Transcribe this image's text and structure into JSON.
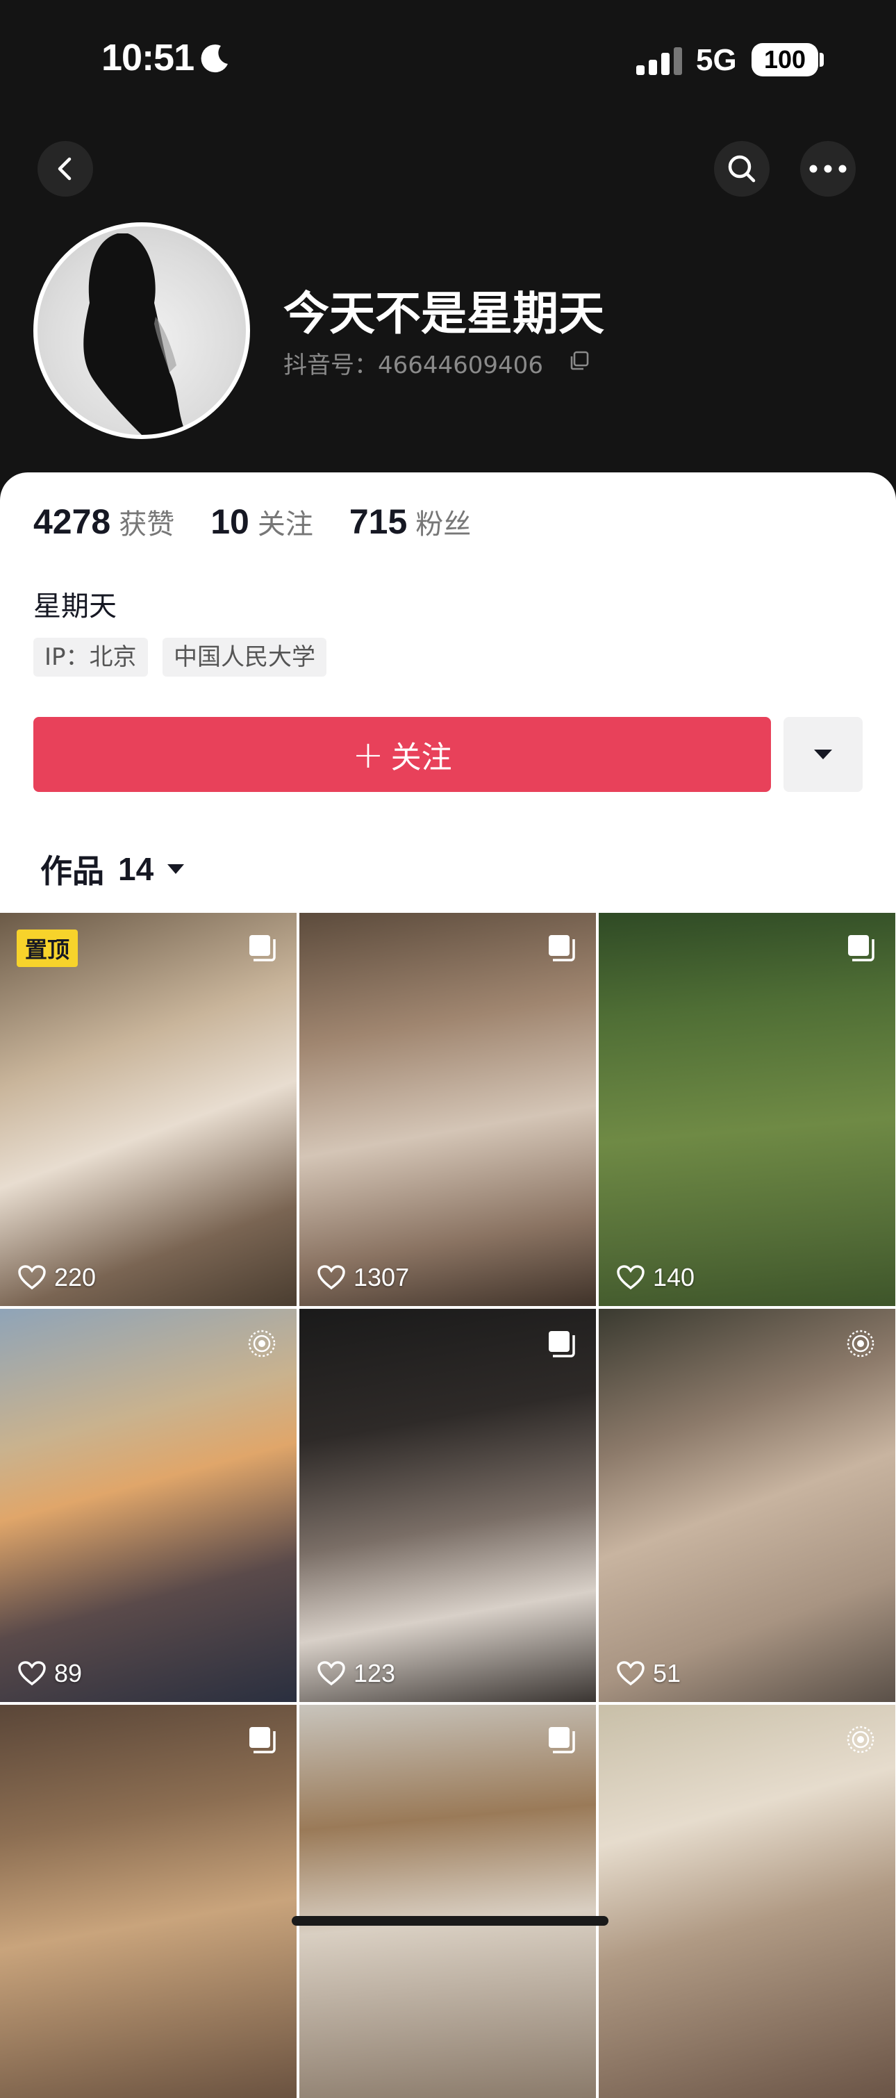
{
  "status_bar": {
    "time": "10:51",
    "network": "5G",
    "battery": "100"
  },
  "profile": {
    "nickname": "今天不是星期天",
    "douyin_id": "抖音号：46644609406",
    "bio": "星期天",
    "tags": [
      "IP：北京",
      "中国人民大学"
    ]
  },
  "stats": [
    {
      "value": "4278",
      "label": "获赞"
    },
    {
      "value": "10",
      "label": "关注"
    },
    {
      "value": "715",
      "label": "粉丝"
    }
  ],
  "actions": {
    "follow_label": "关注"
  },
  "works": {
    "tab_label": "作品",
    "count": "14",
    "pinned_label": "置顶",
    "items": [
      {
        "likes": "220",
        "type": "multi-image-icon",
        "pinned": true
      },
      {
        "likes": "1307",
        "type": "multi-image-icon",
        "pinned": false
      },
      {
        "likes": "140",
        "type": "multi-image-icon",
        "pinned": false
      },
      {
        "likes": "89",
        "type": "live-photo-icon",
        "pinned": false
      },
      {
        "likes": "123",
        "type": "multi-image-icon",
        "pinned": false
      },
      {
        "likes": "51",
        "type": "live-photo-icon",
        "pinned": false
      },
      {
        "likes": "",
        "type": "multi-image-icon",
        "pinned": false
      },
      {
        "likes": "",
        "type": "multi-image-icon",
        "pinned": false
      },
      {
        "likes": "",
        "type": "live-photo-icon",
        "pinned": false
      }
    ]
  },
  "colors": {
    "header_bg": "#141414",
    "follow_red": "#e8415a",
    "pinned_yellow": "#f7d32b"
  }
}
